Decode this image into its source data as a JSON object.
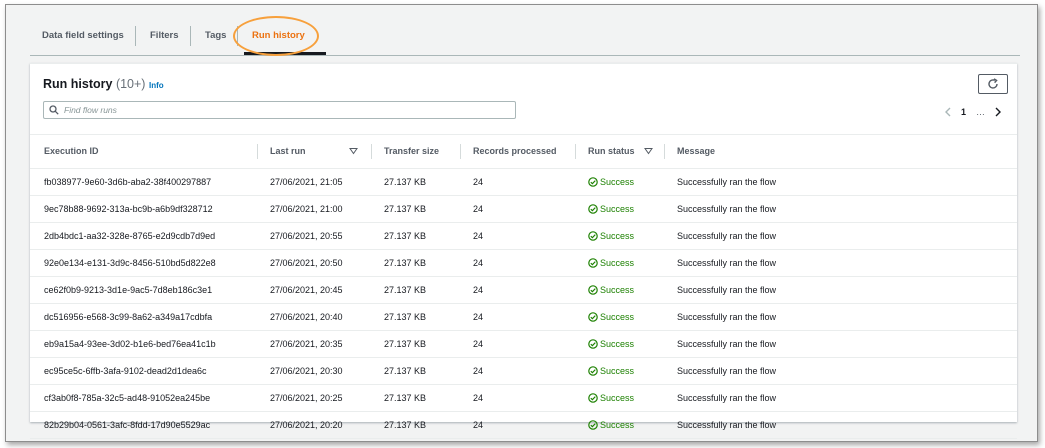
{
  "tabs": [
    {
      "label": "Data field settings",
      "active": false
    },
    {
      "label": "Filters",
      "active": false
    },
    {
      "label": "Tags",
      "active": false
    },
    {
      "label": "Run history",
      "active": true
    }
  ],
  "panel": {
    "title": "Run history",
    "count": "(10+)",
    "info_label": "Info",
    "search_placeholder": "Find flow runs",
    "refresh_icon": "refresh-icon"
  },
  "pagination": {
    "current_page": "1",
    "more": "…"
  },
  "table": {
    "columns": [
      "Execution ID",
      "Last run",
      "Transfer size",
      "Records processed",
      "Run status",
      "Message"
    ],
    "rows": [
      {
        "id": "fb038977-9e60-3d6b-aba2-38f400297887",
        "last_run": "27/06/2021, 21:05",
        "size": "27.137 KB",
        "records": "24",
        "status": "Success",
        "message": "Successfully ran the flow"
      },
      {
        "id": "9ec78b88-9692-313a-bc9b-a6b9df328712",
        "last_run": "27/06/2021, 21:00",
        "size": "27.137 KB",
        "records": "24",
        "status": "Success",
        "message": "Successfully ran the flow"
      },
      {
        "id": "2db4bdc1-aa32-328e-8765-e2d9cdb7d9ed",
        "last_run": "27/06/2021, 20:55",
        "size": "27.137 KB",
        "records": "24",
        "status": "Success",
        "message": "Successfully ran the flow"
      },
      {
        "id": "92e0e134-e131-3d9c-8456-510bd5d822e8",
        "last_run": "27/06/2021, 20:50",
        "size": "27.137 KB",
        "records": "24",
        "status": "Success",
        "message": "Successfully ran the flow"
      },
      {
        "id": "ce62f0b9-9213-3d1e-9ac5-7d8eb186c3e1",
        "last_run": "27/06/2021, 20:45",
        "size": "27.137 KB",
        "records": "24",
        "status": "Success",
        "message": "Successfully ran the flow"
      },
      {
        "id": "dc516956-e568-3c99-8a62-a349a17cdbfa",
        "last_run": "27/06/2021, 20:40",
        "size": "27.137 KB",
        "records": "24",
        "status": "Success",
        "message": "Successfully ran the flow"
      },
      {
        "id": "eb9a15a4-93ee-3d02-b1e6-bed76ea41c1b",
        "last_run": "27/06/2021, 20:35",
        "size": "27.137 KB",
        "records": "24",
        "status": "Success",
        "message": "Successfully ran the flow"
      },
      {
        "id": "ec95ce5c-6ffb-3afa-9102-dead2d1dea6c",
        "last_run": "27/06/2021, 20:30",
        "size": "27.137 KB",
        "records": "24",
        "status": "Success",
        "message": "Successfully ran the flow"
      },
      {
        "id": "cf3ab0f8-785a-32c5-ad48-91052ea245be",
        "last_run": "27/06/2021, 20:25",
        "size": "27.137 KB",
        "records": "24",
        "status": "Success",
        "message": "Successfully ran the flow"
      },
      {
        "id": "82b29b04-0561-3afc-8fdd-17d90e5529ac",
        "last_run": "27/06/2021, 20:20",
        "size": "27.137 KB",
        "records": "24",
        "status": "Success",
        "message": "Successfully ran the flow"
      }
    ]
  },
  "colors": {
    "active_tab": "#ec7211",
    "highlight": "#f7a03c",
    "success": "#1d8102",
    "link": "#0073bb"
  }
}
